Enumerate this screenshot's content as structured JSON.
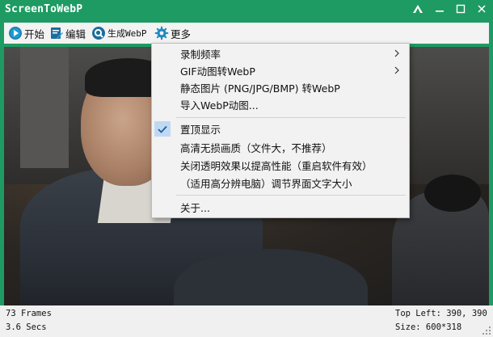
{
  "window": {
    "title": "ScreenToWebP"
  },
  "titlebar_buttons": [
    {
      "name": "pin-icon"
    },
    {
      "name": "minimize-icon"
    },
    {
      "name": "maximize-icon"
    },
    {
      "name": "close-icon"
    }
  ],
  "toolbar": {
    "start_label": "开始",
    "edit_label": "编辑",
    "generate_label": "生成WebP",
    "more_label": "更多"
  },
  "menu": {
    "items": [
      {
        "label": "录制频率",
        "submenu": true,
        "checked": false
      },
      {
        "label": "GIF动图转WebP",
        "submenu": true,
        "checked": false
      },
      {
        "label": "静态图片 (PNG/JPG/BMP) 转WebP",
        "submenu": false,
        "checked": false
      },
      {
        "label": "导入WebP动图...",
        "submenu": false,
        "checked": false
      },
      {
        "label": "置顶显示",
        "submenu": false,
        "checked": true
      },
      {
        "label": "高清无损画质（文件大，不推荐）",
        "submenu": false,
        "checked": false
      },
      {
        "label": "关闭透明效果以提高性能（重启软件有效）",
        "submenu": false,
        "checked": false
      },
      {
        "label": "（适用高分辨电脑）调节界面文字大小",
        "submenu": false,
        "checked": false
      },
      {
        "label": "关于...",
        "submenu": false,
        "checked": false
      }
    ]
  },
  "status": {
    "frames": "73 Frames",
    "secs": "3.6 Secs",
    "top_left": "Top Left: 390, 390",
    "size": "Size: 600*318"
  },
  "colors": {
    "accent": "#1e9b63",
    "menu_bg": "#f2f2f2",
    "check_highlight": "#bfd9f3"
  }
}
